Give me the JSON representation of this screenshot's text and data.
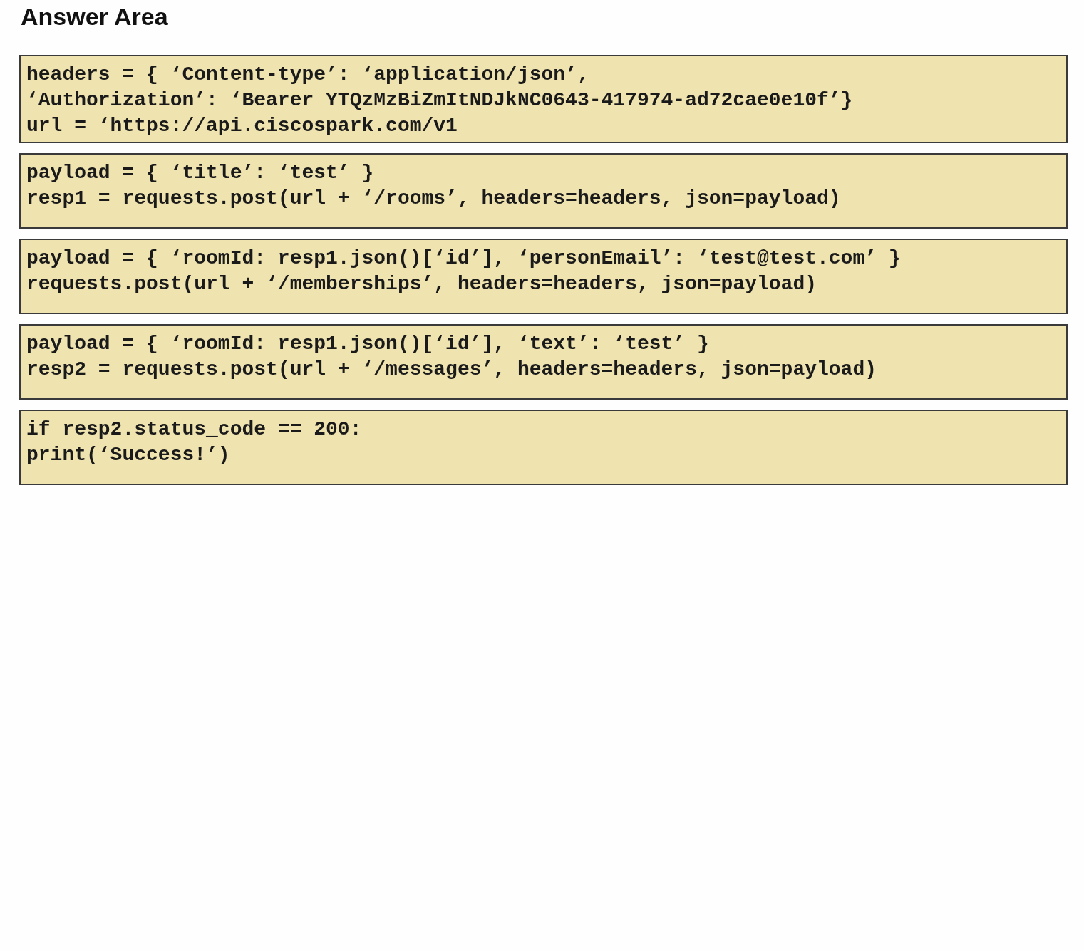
{
  "title": "Answer Area",
  "blocks": [
    {
      "lines": [
        "headers = { ‘Content-type’: ‘application/json’,",
        "‘Authorization’: ‘Bearer YTQzMzBiZmItNDJkNC0643-417974-ad72cae0e10f’}",
        "url = ‘https://api.ciscospark.com/v1"
      ]
    },
    {
      "lines": [
        "payload = { ‘title’: ‘test’ }",
        "resp1 = requests.post(url + ‘/rooms’, headers=headers, json=payload)"
      ]
    },
    {
      "lines": [
        "payload = { ‘roomId: resp1.json()[‘id’], ‘personEmail’: ‘test@test.com’ }",
        "requests.post(url + ‘/memberships’, headers=headers, json=payload)"
      ]
    },
    {
      "lines": [
        "payload = { ‘roomId: resp1.json()[‘id’], ‘text’: ‘test’ }",
        "resp2 = requests.post(url + ‘/messages’, headers=headers, json=payload)"
      ]
    },
    {
      "lines": [
        "if resp2.status_code == 200:",
        "print(‘Success!’)"
      ]
    }
  ]
}
